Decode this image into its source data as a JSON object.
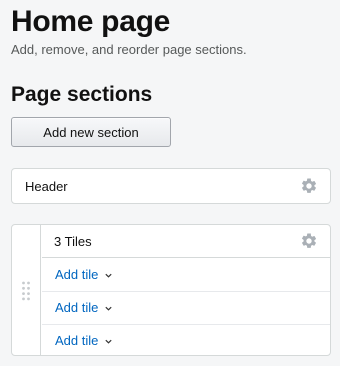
{
  "page": {
    "title": "Home page",
    "subtitle": "Add, remove, and reorder page sections."
  },
  "sections_panel": {
    "heading": "Page sections",
    "add_button_label": "Add new section"
  },
  "sections": [
    {
      "label": "Header",
      "settings_icon": "gear-icon"
    },
    {
      "label": "3 Tiles",
      "settings_icon": "gear-icon",
      "drag_icon": "drag-handle-icon",
      "tiles": [
        {
          "label": "Add tile",
          "icon": "chevron-down-icon"
        },
        {
          "label": "Add tile",
          "icon": "chevron-down-icon"
        },
        {
          "label": "Add tile",
          "icon": "chevron-down-icon"
        }
      ]
    }
  ],
  "colors": {
    "link": "#0066c0",
    "border": "#d5d9d9",
    "background": "#f5f6f7",
    "icon": "#aab0b6"
  }
}
